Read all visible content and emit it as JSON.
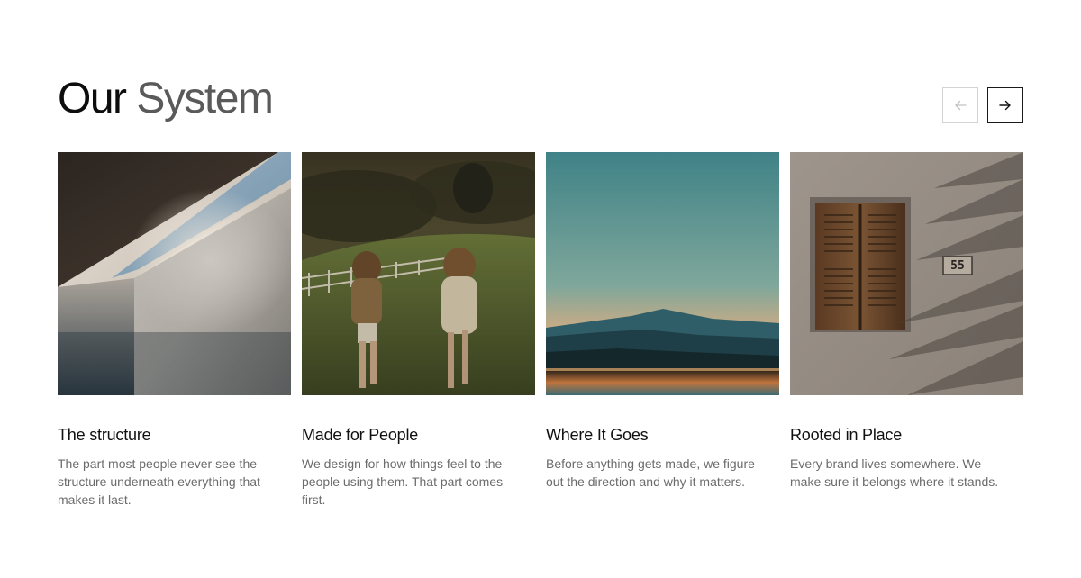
{
  "header": {
    "title_word1": "Our",
    "title_word2": "System",
    "prev_icon": "arrow-left-icon",
    "next_icon": "arrow-right-icon"
  },
  "cards": [
    {
      "title": "The structure",
      "description": "The part most people never see the structure underneath everything that makes it last.",
      "image_alt": "Concrete wall angle against sky"
    },
    {
      "title": "Made for People",
      "description": "We design for how things feel to the people using them. That part comes first.",
      "image_alt": "Two girls running in a green field"
    },
    {
      "title": "Where It Goes",
      "description": "Before anything gets made, we figure out the direction and why it matters.",
      "image_alt": "Mountain silhouette at dusk over water"
    },
    {
      "title": "Rooted in Place",
      "description": "Every brand lives somewhere. We make sure it belongs where it stands.",
      "image_alt": "Wooden shutter window with number 55 and palm shadows",
      "house_number": "55"
    }
  ],
  "colors": {
    "title_primary": "#0d0d0d",
    "title_secondary": "#5a5a5a",
    "description": "#6b6b6b",
    "button_border_active": "#1a1a1a",
    "button_border_disabled": "#d4d4d4"
  }
}
